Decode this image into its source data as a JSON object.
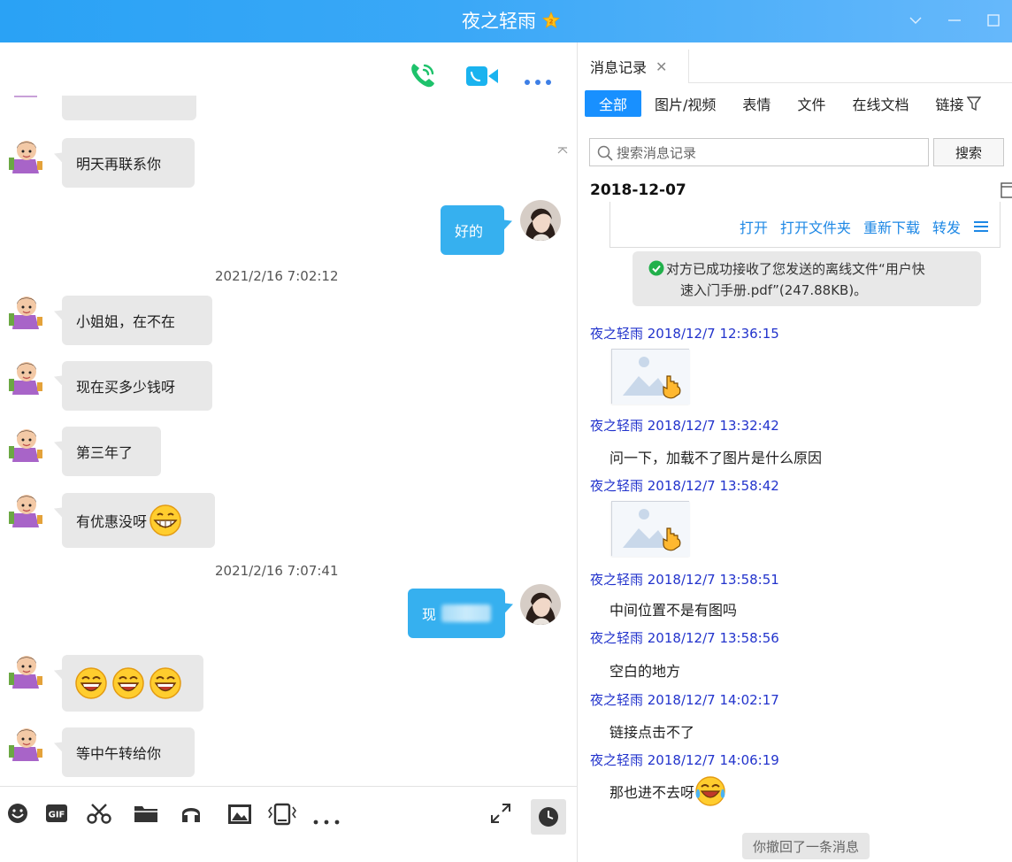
{
  "window": {
    "title": "夜之轻雨",
    "colors": {
      "accent": "#36b0ef",
      "link": "#1e88e5",
      "sender": "#2233cc",
      "tab_active": "#1890ff"
    }
  },
  "chat": {
    "messages": [
      {
        "id": "m1",
        "dir": "in",
        "text": "明天再联系你"
      },
      {
        "id": "m2",
        "dir": "out",
        "text": "好的"
      },
      {
        "id": "t1",
        "type": "time",
        "text": "2021/2/16 7:02:12"
      },
      {
        "id": "m3",
        "dir": "in",
        "text": "小姐姐，在不在"
      },
      {
        "id": "m4",
        "dir": "in",
        "text": "现在买多少钱呀"
      },
      {
        "id": "m5",
        "dir": "in",
        "text": "第三年了"
      },
      {
        "id": "m6",
        "dir": "in",
        "text": "有优惠没呀",
        "emoji": "grin-emoji"
      },
      {
        "id": "t2",
        "type": "time",
        "text": "2021/2/16 7:07:41"
      },
      {
        "id": "m7",
        "dir": "out",
        "text": "现"
      },
      {
        "id": "m8",
        "dir": "in",
        "emoji": "laugh-emoji-x3"
      },
      {
        "id": "m9",
        "dir": "in",
        "text": "等中午转给你"
      }
    ],
    "bottom_toolbar": [
      "emoji-icon",
      "gif-icon",
      "scissors-icon",
      "folder-icon",
      "music-icon",
      "image-icon",
      "shake-icon",
      "more-icon"
    ],
    "gif_label": "GIF"
  },
  "history": {
    "tab_label": "消息记录",
    "filters": [
      "全部",
      "图片/视频",
      "表情",
      "文件",
      "在线文档",
      "链接"
    ],
    "search_placeholder": "搜索消息记录",
    "search_button": "搜索",
    "date": "2018-12-07",
    "file_actions": [
      "打开",
      "打开文件夹",
      "重新下载",
      "转发"
    ],
    "notice_line1": "对方已成功接收了您发送的离线文件“用户快",
    "notice_line2": "速入门手册.pdf”(247.88KB)。",
    "entries": [
      {
        "sender": "夜之轻雨 2018/12/7 12:36:15",
        "kind": "image"
      },
      {
        "sender": "夜之轻雨 2018/12/7 13:32:42",
        "kind": "text",
        "text": "问一下，加载不了图片是什么原因"
      },
      {
        "sender": "夜之轻雨 2018/12/7 13:58:42",
        "kind": "image"
      },
      {
        "sender": "夜之轻雨 2018/12/7 13:58:51",
        "kind": "text",
        "text": "中间位置不是有图吗"
      },
      {
        "sender": "夜之轻雨 2018/12/7 13:58:56",
        "kind": "text",
        "text": "空白的地方"
      },
      {
        "sender": "夜之轻雨 2018/12/7 14:02:17",
        "kind": "text",
        "text": "链接点击不了"
      },
      {
        "sender": "夜之轻雨 2018/12/7 14:06:19",
        "kind": "text",
        "text": "那也进不去呀",
        "emoji": "cry-laugh-emoji"
      }
    ],
    "recall_notice": "你撤回了一条消息"
  }
}
